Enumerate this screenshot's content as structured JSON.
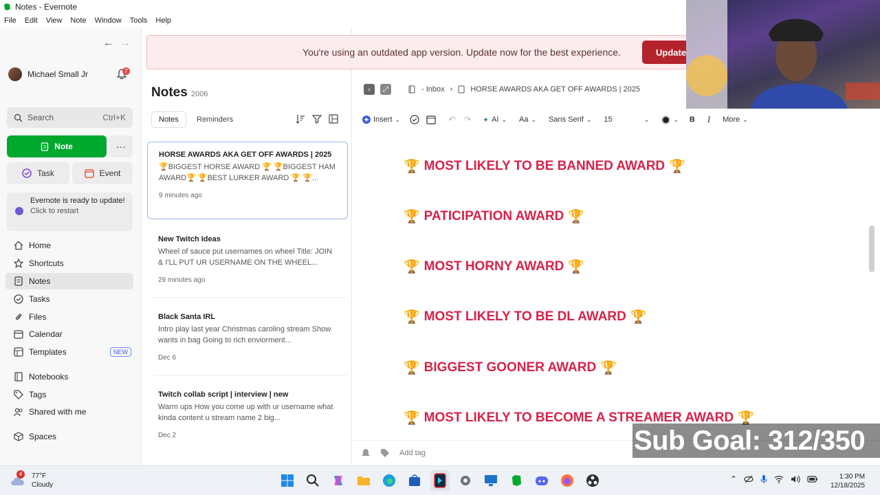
{
  "window": {
    "title": "Notes - Evernote"
  },
  "menu": [
    "File",
    "Edit",
    "View",
    "Note",
    "Window",
    "Tools",
    "Help"
  ],
  "sidebar": {
    "user_name": "Michael Small Jr",
    "notification_count": "7",
    "search_placeholder": "Search",
    "search_shortcut": "Ctrl+K",
    "new_note_label": "Note",
    "task_label": "Task",
    "event_label": "Event",
    "update_title": "Evernote is ready to update!",
    "update_sub": "Click to restart",
    "items": [
      {
        "label": "Home"
      },
      {
        "label": "Shortcuts"
      },
      {
        "label": "Notes"
      },
      {
        "label": "Tasks"
      },
      {
        "label": "Files"
      },
      {
        "label": "Calendar"
      },
      {
        "label": "Templates",
        "badge": "NEW"
      },
      {
        "label": "Notebooks"
      },
      {
        "label": "Tags"
      },
      {
        "label": "Shared with me"
      },
      {
        "label": "Spaces"
      }
    ],
    "accent_color": "#00a82d"
  },
  "notelist": {
    "title": "Notes",
    "count": "2006",
    "tabs": [
      "Notes",
      "Reminders"
    ],
    "notes": [
      {
        "title": "HORSE AWARDS AKA GET OFF AWARDS | 2025",
        "snippet": "🏆BIGGEST HORSE AWARD 🏆 🏆BIGGEST HAM AWARD🏆 🏆BEST LURKER AWARD 🏆 🏆...",
        "date": "9 minutes ago"
      },
      {
        "title": "New Twitch Ideas",
        "snippet": "Wheel of sauce put usernames on wheel Title: JOIN & I'LL PUT UR USERNAME ON THE WHEEL...",
        "date": "29 minutes ago"
      },
      {
        "title": "Black Santa IRL",
        "snippet": "Intro play last year Christmas caroling stream Show wants in bag Going to rich enviorment...",
        "date": "Dec 6"
      },
      {
        "title": "Twitch collab script | interview | new",
        "snippet": "Warm ups How you come up with ur username what kinda content u stream name 2 big...",
        "date": "Dec 2"
      }
    ]
  },
  "banner": {
    "message": "You're using an outdated app version. Update now for the best experience.",
    "button": "Update"
  },
  "editor": {
    "breadcrumb_notebook": "- Inbox",
    "breadcrumb_note": "HORSE AWARDS AKA GET OFF AWARDS | 2025",
    "toolbar": {
      "insert": "Insert",
      "ai": "AI",
      "aa": "Aa",
      "font": "Sans Serif",
      "size": "15",
      "bold": "B",
      "italic": "I",
      "more": "More"
    },
    "lines": [
      "MOST LIKELY TO BE BANNED AWARD",
      "PATICIPATION AWARD",
      "MOST HORNY AWARD",
      "MOST LIKELY TO BE DL AWARD",
      "BIGGEST GOONER AWARD",
      "MOST LIKELY TO BECOME A STREAMER AWARD"
    ],
    "text_color": "#d6234a",
    "add_tag": "Add tag"
  },
  "overlay": {
    "sub_goal": "Sub Goal: 312/350"
  },
  "taskbar": {
    "weather_temp": "77°F",
    "weather_desc": "Cloudy",
    "weather_badge": "4",
    "time": "1:30 PM",
    "date": "12/18/2025"
  }
}
